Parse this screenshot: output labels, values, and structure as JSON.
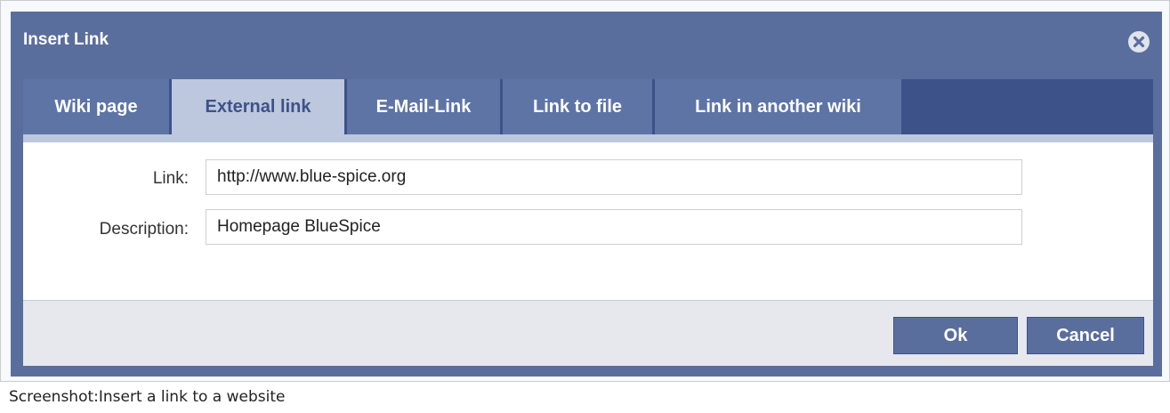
{
  "dialog": {
    "title": "Insert Link",
    "close_icon": "close-circle-icon"
  },
  "tabs": [
    {
      "label": "Wiki page",
      "active": false
    },
    {
      "label": "External link",
      "active": true
    },
    {
      "label": "E-Mail-Link",
      "active": false
    },
    {
      "label": "Link to file",
      "active": false
    },
    {
      "label": "Link in another wiki",
      "active": false
    }
  ],
  "form": {
    "link_label": "Link:",
    "link_value": "http://www.blue-spice.org",
    "description_label": "Description:",
    "description_value": "Homepage BlueSpice"
  },
  "buttons": {
    "ok": "Ok",
    "cancel": "Cancel"
  },
  "caption": "Screenshot:Insert a link to a website",
  "colors": {
    "dialog_bg": "#5a6e9d",
    "tabbar_bg": "#3d5288",
    "active_tab_bg": "#bdc7dd",
    "active_tab_text": "#3d5288"
  }
}
